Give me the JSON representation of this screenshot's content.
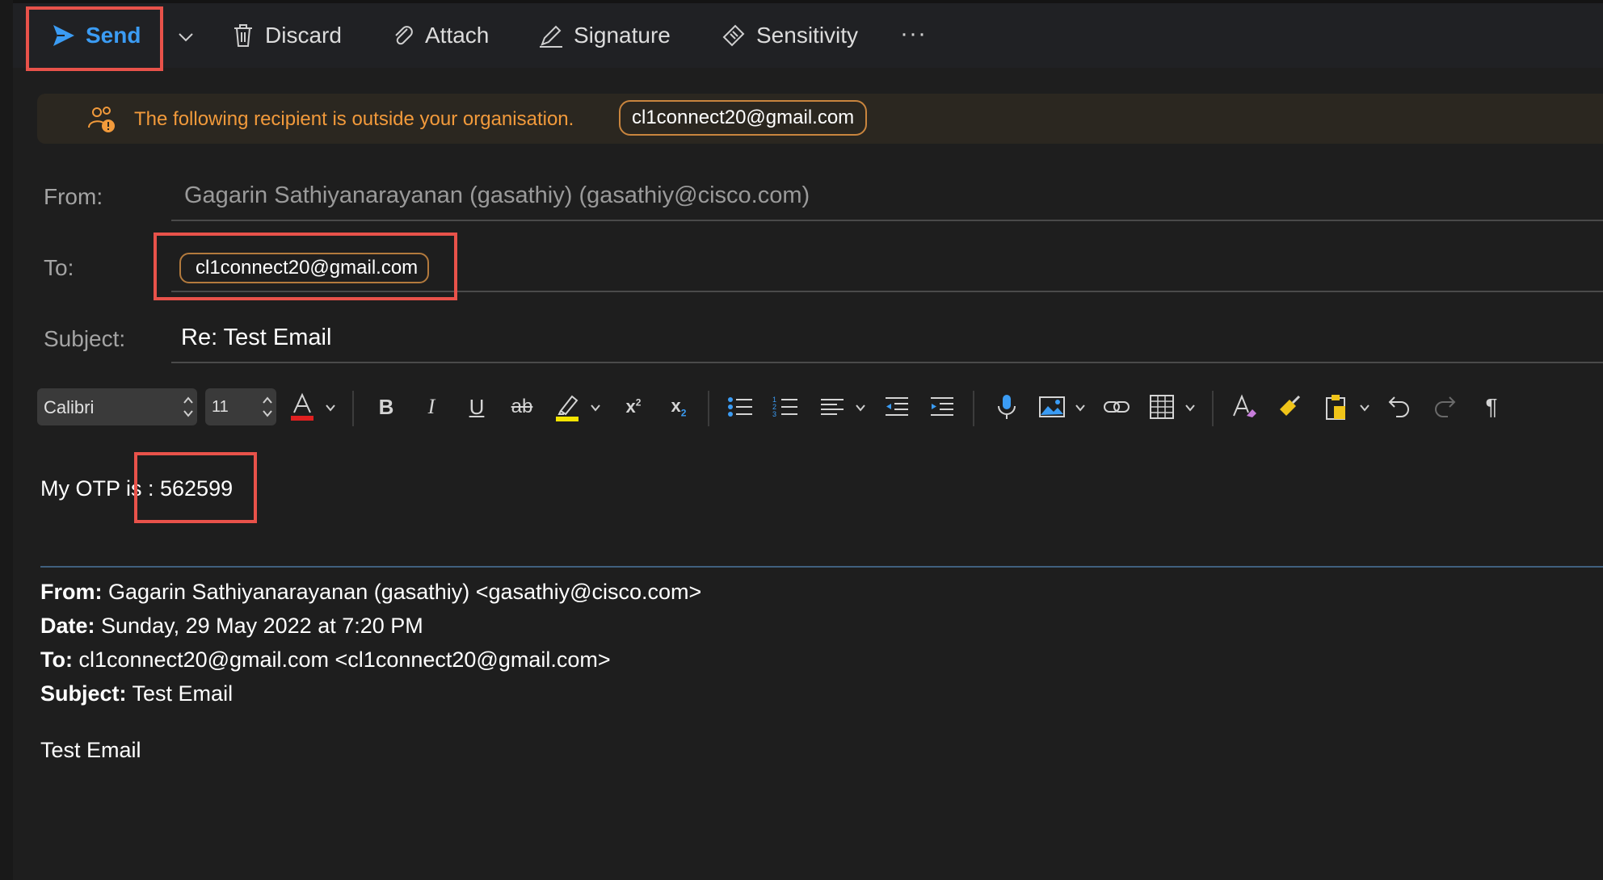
{
  "toolbar": {
    "send_label": "Send",
    "discard_label": "Discard",
    "attach_label": "Attach",
    "signature_label": "Signature",
    "sensitivity_label": "Sensitivity",
    "more_label": "···"
  },
  "banner": {
    "message": "The following recipient is outside your organisation.",
    "recipient": "cl1connect20@gmail.com"
  },
  "fields": {
    "from_label": "From:",
    "from_value": "Gagarin Sathiyanarayanan (gasathiy) (gasathiy@cisco.com)",
    "to_label": "To:",
    "to_recipient": "cl1connect20@gmail.com",
    "subject_label": "Subject:",
    "subject_value": "Re: Test Email"
  },
  "format": {
    "font": "Calibri",
    "size": "11"
  },
  "body": {
    "text": "My OTP is : 562599"
  },
  "quoted": {
    "from_label": "From:",
    "from_value": " Gagarin Sathiyanarayanan (gasathiy) <gasathiy@cisco.com>",
    "date_label": "Date:",
    "date_value": " Sunday, 29 May 2022 at 7:20 PM",
    "to_label": "To:",
    "to_value": " cl1connect20@gmail.com <cl1connect20@gmail.com>",
    "subject_label": "Subject:",
    "subject_value": " Test Email",
    "body": "Test Email"
  },
  "colors": {
    "accent": "#3b9cf4",
    "warning": "#f29a3b",
    "highlight_box": "#e8524a",
    "background": "#1e1e1e"
  }
}
